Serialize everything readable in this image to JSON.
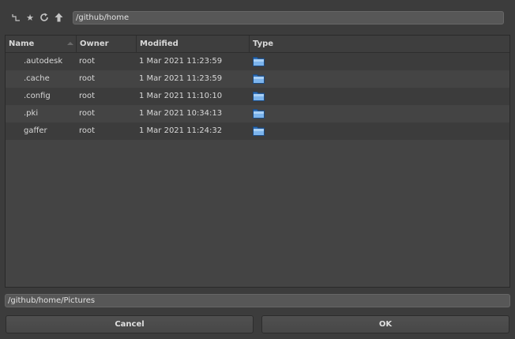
{
  "toolbar": {
    "icons": [
      "hierarchy-up-icon",
      "bookmark-star-icon",
      "refresh-icon",
      "up-arrow-icon"
    ],
    "path": "/github/home"
  },
  "list": {
    "columns": {
      "name": "Name",
      "owner": "Owner",
      "modified": "Modified",
      "type": "Type"
    },
    "sort": "name-ascending",
    "rows": [
      {
        "name": ".autodesk",
        "owner": "root",
        "modified": "1 Mar 2021 11:23:59",
        "type_icon": "folder-icon"
      },
      {
        "name": ".cache",
        "owner": "root",
        "modified": "1 Mar 2021 11:23:59",
        "type_icon": "folder-icon"
      },
      {
        "name": ".config",
        "owner": "root",
        "modified": "1 Mar 2021 11:10:10",
        "type_icon": "folder-icon"
      },
      {
        "name": ".pki",
        "owner": "root",
        "modified": "1 Mar 2021 10:34:13",
        "type_icon": "folder-icon"
      },
      {
        "name": "gaffer",
        "owner": "root",
        "modified": "1 Mar 2021 11:24:32",
        "type_icon": "folder-icon"
      }
    ]
  },
  "footer": {
    "filename": "/github/home/Pictures",
    "cancel_label": "Cancel",
    "ok_label": "OK"
  }
}
